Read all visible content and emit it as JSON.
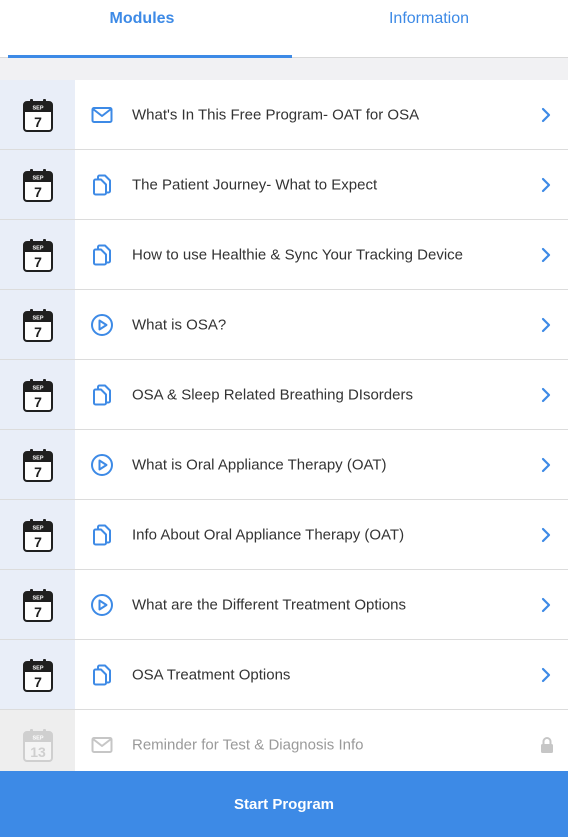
{
  "tabs": [
    {
      "label": "Modules",
      "active": true
    },
    {
      "label": "Information",
      "active": false
    }
  ],
  "colors": {
    "accent": "#3d8ae6",
    "date_column": "#e9eef8",
    "locked": "#c6c6c6"
  },
  "modules": [
    {
      "date_month": "SEP",
      "date_day": "7",
      "type_icon": "mail-icon",
      "title": "What's In This Free Program- OAT for OSA",
      "locked": false
    },
    {
      "date_month": "SEP",
      "date_day": "7",
      "type_icon": "document-icon",
      "title": "The Patient Journey- What to Expect",
      "locked": false
    },
    {
      "date_month": "SEP",
      "date_day": "7",
      "type_icon": "document-icon",
      "title": "How to use Healthie & Sync Your Tracking Device",
      "locked": false
    },
    {
      "date_month": "SEP",
      "date_day": "7",
      "type_icon": "play-icon",
      "title": "What is OSA?",
      "locked": false
    },
    {
      "date_month": "SEP",
      "date_day": "7",
      "type_icon": "document-icon",
      "title": "OSA & Sleep Related Breathing DIsorders",
      "locked": false
    },
    {
      "date_month": "SEP",
      "date_day": "7",
      "type_icon": "play-icon",
      "title": "What is Oral Appliance Therapy (OAT)",
      "locked": false
    },
    {
      "date_month": "SEP",
      "date_day": "7",
      "type_icon": "document-icon",
      "title": "Info About Oral Appliance Therapy (OAT)",
      "locked": false
    },
    {
      "date_month": "SEP",
      "date_day": "7",
      "type_icon": "play-icon",
      "title": "What are the  Different Treatment Options",
      "locked": false
    },
    {
      "date_month": "SEP",
      "date_day": "7",
      "type_icon": "document-icon",
      "title": "OSA Treatment Options",
      "locked": false
    },
    {
      "date_month": "SEP",
      "date_day": "13",
      "type_icon": "mail-icon",
      "title": "Reminder for Test & Diagnosis Info",
      "locked": true
    }
  ],
  "start_button": {
    "label": "Start Program"
  }
}
